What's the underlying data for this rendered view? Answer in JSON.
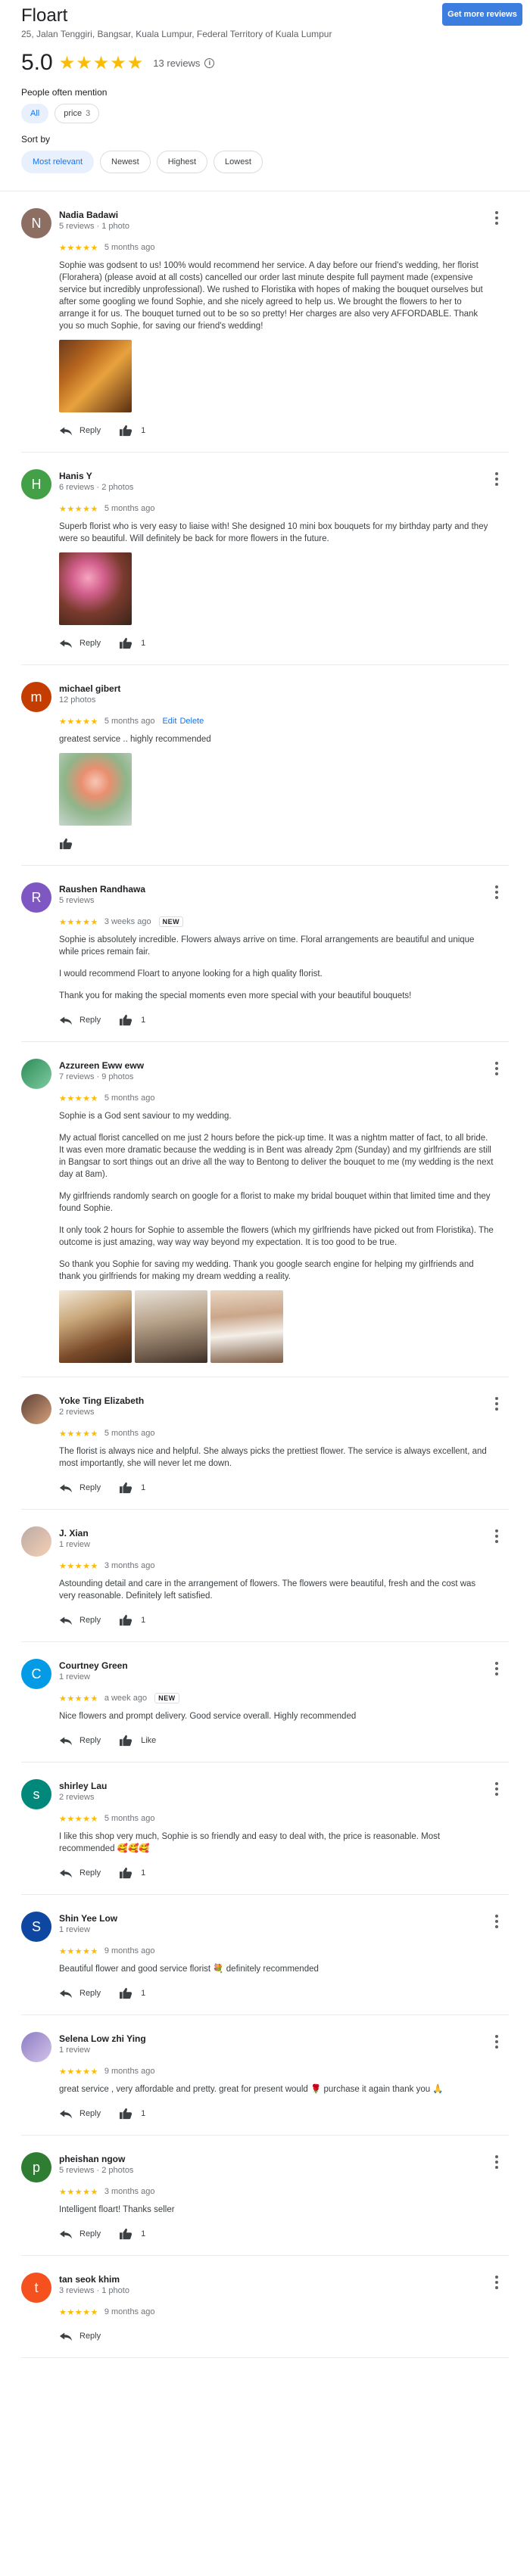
{
  "place": {
    "name": "Floart",
    "address": "25, Jalan Tenggiri, Bangsar, Kuala Lumpur, Federal Territory of Kuala Lumpur",
    "more_reviews_label": "Get more reviews",
    "rating": "5.0",
    "review_count": "13 reviews",
    "info_glyph": "i"
  },
  "mentions": {
    "label": "People often mention",
    "chips": [
      {
        "label": "All",
        "count": ""
      },
      {
        "label": "price",
        "count": "3"
      }
    ]
  },
  "sort": {
    "label": "Sort by",
    "options": [
      "Most relevant",
      "Newest",
      "Highest",
      "Lowest"
    ],
    "selected": "Most relevant"
  },
  "reviews": [
    {
      "name": "Nadia Badawi",
      "meta": "5 reviews · 1 photo",
      "initial": "N",
      "avatar_color": "#8d6e63",
      "stars": "★★★★★",
      "ago": "5 months ago",
      "text": [
        "Sophie was godsent to us! 100% would recommend her service. A day before our friend's wedding, her florist (Florahera) (please avoid at all costs) cancelled our order last minute despite full payment made (expensive service but incredibly unprofessional). We rushed to Floristika with hopes of making the bouquet ourselves but after some googling we found Sophie, and she nicely agreed to help us. We brought the flowers to her to arrange it for us. The bouquet turned out to be so so pretty! Her charges are also very AFFORDABLE. Thank you so much Sophie, for saving our friend's wedding!"
      ],
      "reply": "Reply",
      "likes": "1"
    },
    {
      "name": "Hanis Y",
      "meta": "6 reviews · 2 photos",
      "initial": "H",
      "avatar_color": "#43a047",
      "stars": "★★★★★",
      "ago": "5 months ago",
      "text": [
        "Superb florist who is very easy to liaise with! She designed 10 mini box bouquets for my birthday party and they were so beautiful. Will definitely be back for more flowers in the future."
      ],
      "reply": "Reply",
      "likes": "1"
    },
    {
      "name": "michael gibert",
      "meta": "12 photos",
      "initial": "m",
      "avatar_color": "#c43c00",
      "stars": "★★★★★",
      "ago": "5 months ago",
      "edit": "Edit",
      "delete": "Delete",
      "text": [
        "greatest service .. highly recommended"
      ]
    },
    {
      "name": "Raushen Randhawa",
      "meta": "5 reviews",
      "initial": "R",
      "avatar_color": "#7e57c2",
      "stars": "★★★★★",
      "ago": "3 weeks ago",
      "badge": "NEW",
      "text": [
        "Sophie is absolutely incredible. Flowers always arrive on time. Floral arrangements are beautiful and unique while prices remain fair.",
        "I would recommend Floart to anyone looking for a high quality florist.",
        "Thank you for making the special moments even more special with your beautiful bouquets!"
      ],
      "reply": "Reply",
      "likes": "1"
    },
    {
      "name": "Azzureen Eww eww",
      "meta": "7 reviews · 9 photos",
      "initial": "A",
      "avatar_color": "#26a69a",
      "stars": "★★★★★",
      "ago": "5 months ago",
      "text": [
        "Sophie is a God sent saviour to my wedding.",
        "My actual florist cancelled on me just 2 hours before the pick-up time. It was a nightm matter of fact, to all bride. It was even more dramatic because the wedding is in Bent was already 2pm (Sunday) and my girlfriends are still in Bangsar to sort things out an drive all the way to Bentong to deliver the bouquet to me (my wedding is the next day at 8am).",
        "My girlfriends randomly search on google for a florist to make my bridal bouquet within that limited time and they found Sophie.",
        "It only took 2 hours for Sophie to assemble the flowers (which my girlfriends have picked out from Floristika). The outcome is just amazing, way way way beyond my expectation. It is too good to be true.",
        "So thank you Sophie for saving my wedding. Thank you google search engine for helping my girlfriends and thank you girlfriends for making my dream wedding a reality."
      ]
    },
    {
      "name": "Yoke Ting Elizabeth",
      "meta": "2 reviews",
      "initial": "Y",
      "avatar_color": "#6d4c41",
      "stars": "★★★★★",
      "ago": "5 months ago",
      "text": [
        "The florist is always nice and helpful. She always picks the prettiest flower. The service is always excellent, and most importantly, she will never let me down."
      ],
      "reply": "Reply",
      "likes": "1"
    },
    {
      "name": "J. Xian",
      "meta": "1 review",
      "initial": "J",
      "avatar_color": "#a1887f",
      "stars": "★★★★★",
      "ago": "3 months ago",
      "text": [
        "Astounding detail and care in the arrangement of flowers. The flowers were beautiful, fresh and the cost was very reasonable. Definitely left satisfied."
      ],
      "reply": "Reply",
      "likes": "1"
    },
    {
      "name": "Courtney Green",
      "meta": "1 review",
      "initial": "C",
      "avatar_color": "#039be5",
      "stars": "★★★★★",
      "ago": "a week ago",
      "badge": "NEW",
      "text": [
        "Nice flowers and prompt delivery. Good service overall. Highly recommended"
      ],
      "reply": "Reply",
      "likes": "Like"
    },
    {
      "name": "shirley Lau",
      "meta": "2 reviews",
      "initial": "s",
      "avatar_color": "#00897b",
      "stars": "★★★★★",
      "ago": "5 months ago",
      "text": [
        "I like this shop very much, Sophie is so friendly and easy to deal with, the price is reasonable. Most recommended 🥰🥰🥰"
      ],
      "reply": "Reply",
      "likes": "1"
    },
    {
      "name": "Shin Yee Low",
      "meta": "1 review",
      "initial": "S",
      "avatar_color": "#0d47a1",
      "stars": "★★★★★",
      "ago": "9 months ago",
      "text": [
        "Beautiful flower and good service florist 💐 definitely recommended"
      ],
      "reply": "Reply",
      "likes": "1"
    },
    {
      "name": "Selena Low zhi Ying",
      "meta": "1 review",
      "initial": "S",
      "avatar_color": "#7b5ea7",
      "stars": "★★★★★",
      "ago": "9 months ago",
      "text": [
        "great service , very affordable and pretty. great for present would 🌹 purchase it again thank you 🙏"
      ],
      "reply": "Reply",
      "likes": "1"
    },
    {
      "name": "pheishan ngow",
      "meta": "5 reviews · 2 photos",
      "initial": "p",
      "avatar_color": "#2e7d32",
      "stars": "★★★★★",
      "ago": "3 months ago",
      "text": [
        "Intelligent floart! Thanks seller"
      ],
      "reply": "Reply",
      "likes": "1"
    },
    {
      "name": "tan seok khim",
      "meta": "3 reviews · 1 photo",
      "initial": "t",
      "avatar_color": "#f4511e",
      "stars": "★★★★★",
      "ago": "9 months ago",
      "text": [],
      "reply": "Reply"
    }
  ],
  "colors": {
    "accent": "#1a73e8",
    "star": "#fbbc04",
    "button": "#3c7ee0"
  }
}
